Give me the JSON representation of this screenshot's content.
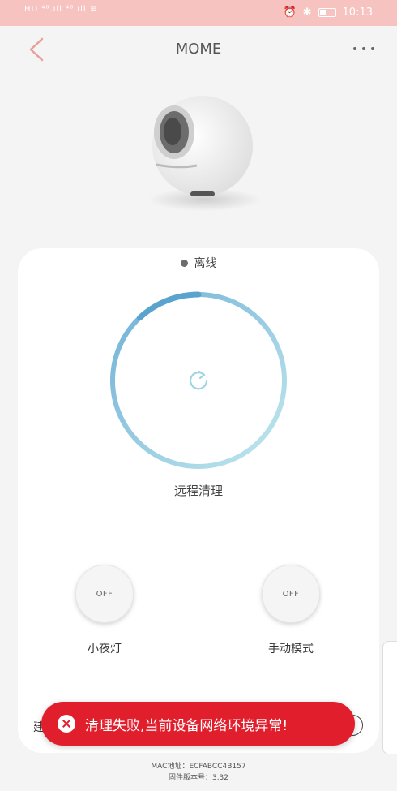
{
  "status_bar": {
    "network": "HD ⁴⁶.ıll ⁴⁶.ıll ≋",
    "time": "10:13",
    "icons": [
      "alarm-icon",
      "bluetooth-icon",
      "battery-icon"
    ]
  },
  "header": {
    "title": "MOME",
    "back_icon": "chevron-left-icon",
    "more_icon": "more-dots-icon"
  },
  "device": {
    "connection_status": "离线",
    "action_label": "远程清理",
    "progress_ring_fill": 0.12,
    "colors": {
      "ring_start": "#5aa3cf",
      "ring_end": "#b7e3ea",
      "accent": "#e8a09c"
    }
  },
  "controls": [
    {
      "state": "OFF",
      "label": "小夜灯"
    },
    {
      "state": "OFF",
      "label": "手动模式"
    }
  ],
  "bottom_row": {
    "left_text": "建"
  },
  "toast": {
    "message": "清理失败,当前设备网络环境异常!",
    "color": "#e11e2c"
  },
  "footer": {
    "mac": "MAC地址：ECFABCC4B157",
    "firmware": "固件版本号：3.32"
  }
}
